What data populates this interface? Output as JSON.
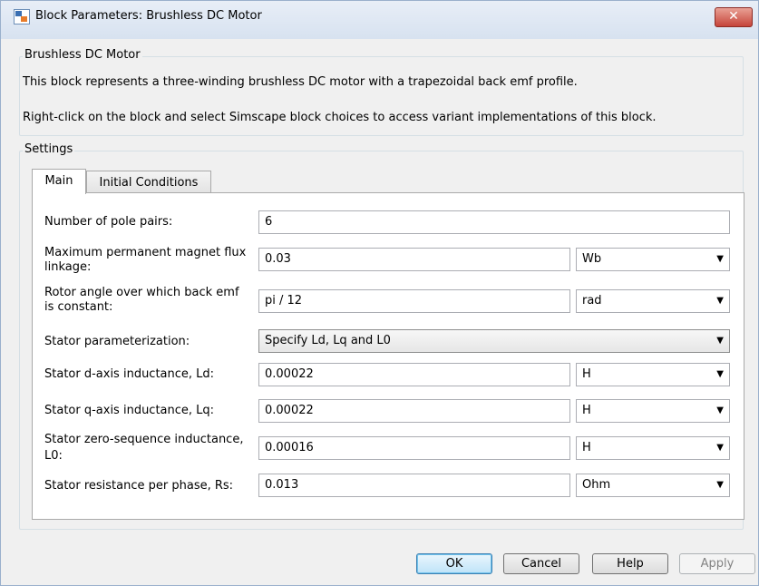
{
  "window": {
    "title": "Block Parameters: Brushless DC Motor",
    "close_glyph": "✕",
    "icon": "simulink-block-icon"
  },
  "block": {
    "group_title": "Brushless DC Motor",
    "description_1": "This block represents a three-winding brushless DC motor with a trapezoidal back emf profile.",
    "description_2": "Right-click on the block and select Simscape block choices to access variant implementations of this block."
  },
  "settings": {
    "group_title": "Settings",
    "tabs": [
      {
        "label": "Main",
        "active": true
      },
      {
        "label": "Initial Conditions",
        "active": false
      }
    ]
  },
  "params": {
    "pole_pairs": {
      "label": "Number of pole pairs:",
      "value": "6"
    },
    "flux_linkage": {
      "label_1": "Maximum permanent magnet flux",
      "label_2": "linkage:",
      "value": "0.03",
      "unit": "Wb"
    },
    "rotor_angle": {
      "label_1": "Rotor angle over which back emf",
      "label_2": "is constant:",
      "value": "pi / 12",
      "unit": "rad"
    },
    "stator_param": {
      "label": "Stator parameterization:",
      "value": "Specify Ld, Lq and L0"
    },
    "ld": {
      "label": "Stator d-axis inductance, Ld:",
      "value": "0.00022",
      "unit": "H"
    },
    "lq": {
      "label": "Stator q-axis inductance, Lq:",
      "value": "0.00022",
      "unit": "H"
    },
    "l0": {
      "label_1": "Stator zero-sequence inductance,",
      "label_2": "L0:",
      "value": "0.00016",
      "unit": "H"
    },
    "rs": {
      "label": "Stator resistance per phase, Rs:",
      "value": "0.013",
      "unit": "Ohm"
    }
  },
  "dropdown_glyph": "▼",
  "buttons": {
    "ok": "OK",
    "cancel": "Cancel",
    "help": "Help",
    "apply": "Apply"
  },
  "colors": {
    "close_button": "#c6443a",
    "default_button_border": "#3c7fb1",
    "tab_panel": "#ffffff"
  }
}
